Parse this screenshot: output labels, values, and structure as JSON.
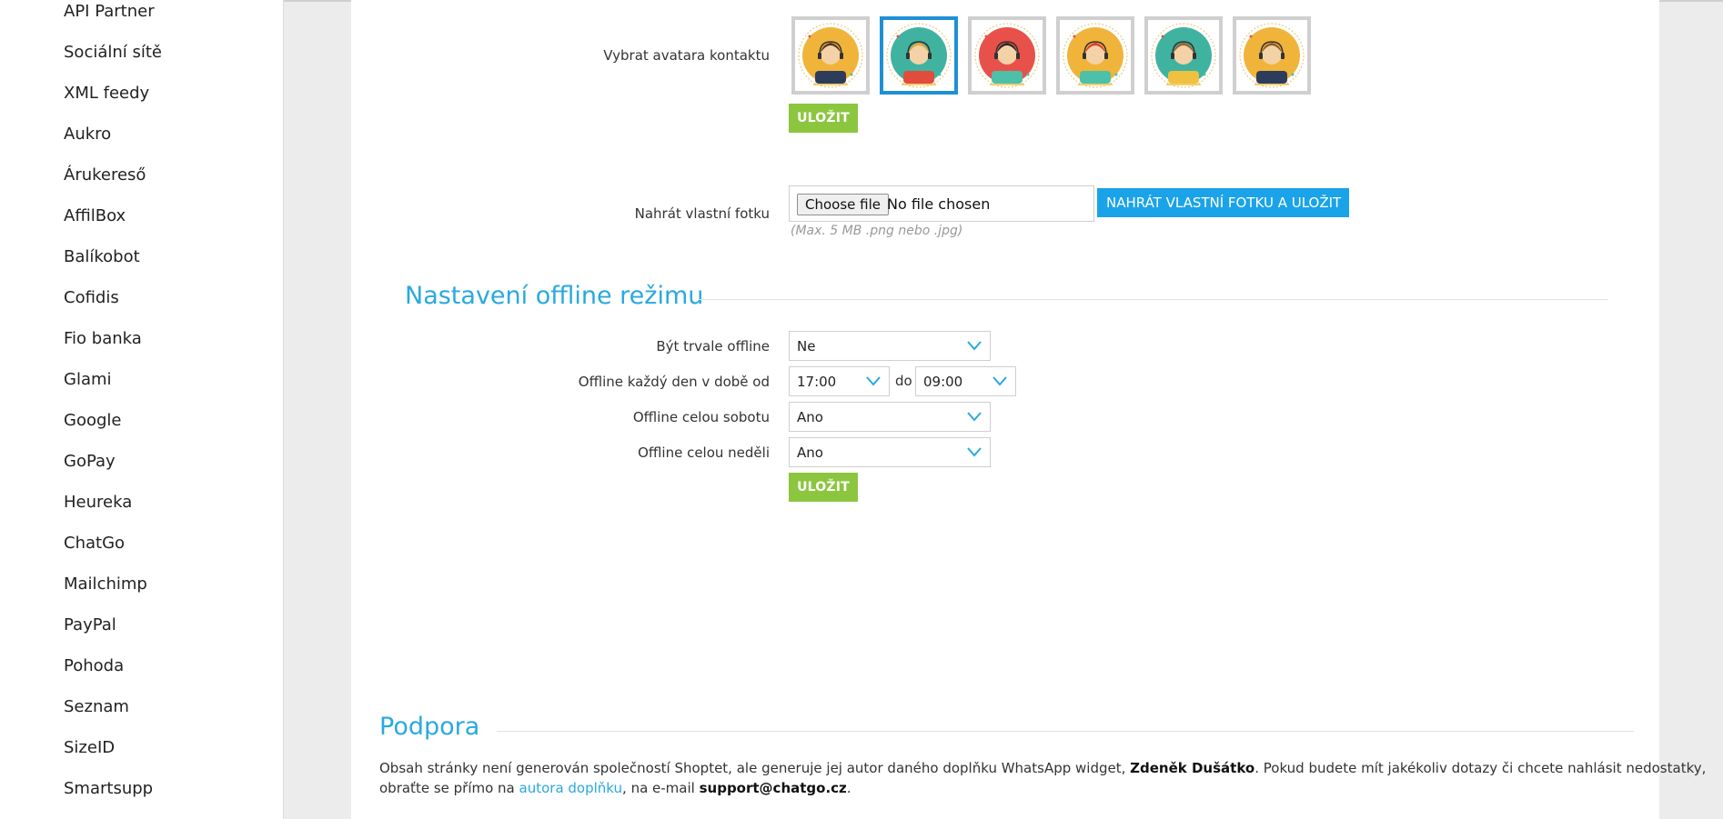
{
  "sidebar": {
    "items": [
      {
        "label": "API Partner"
      },
      {
        "label": "Sociální sítě"
      },
      {
        "label": "XML feedy"
      },
      {
        "label": "Aukro"
      },
      {
        "label": "Árukereső"
      },
      {
        "label": "AffilBox"
      },
      {
        "label": "Balíkobot"
      },
      {
        "label": "Cofidis"
      },
      {
        "label": "Fio banka"
      },
      {
        "label": "Glami"
      },
      {
        "label": "Google"
      },
      {
        "label": "GoPay"
      },
      {
        "label": "Heureka"
      },
      {
        "label": "ChatGo"
      },
      {
        "label": "Mailchimp"
      },
      {
        "label": "PayPal"
      },
      {
        "label": "Pohoda"
      },
      {
        "label": "Seznam"
      },
      {
        "label": "SizeID"
      },
      {
        "label": "Smartsupp"
      }
    ]
  },
  "avatar_section": {
    "label": "Vybrat avatara kontaktu",
    "avatars": [
      {
        "name": "avatar-woman-dark-hair",
        "bg": "#f0b43a",
        "hair": "#5a3420",
        "shirt": "#2c3d5b"
      },
      {
        "name": "avatar-man-blond",
        "bg": "#3fb3a0",
        "hair": "#e8a93a",
        "shirt": "#e24c3c"
      },
      {
        "name": "avatar-woman-black-hair",
        "bg": "#e8514a",
        "hair": "#2a2a2a",
        "shirt": "#4cc0a8"
      },
      {
        "name": "avatar-woman-red-hair",
        "bg": "#f0b43a",
        "hair": "#e03b30",
        "shirt": "#4cc0a8"
      },
      {
        "name": "avatar-man-glasses",
        "bg": "#3fb3a0",
        "hair": "#a0602a",
        "shirt": "#f0c040"
      },
      {
        "name": "avatar-man-beard",
        "bg": "#f0b43a",
        "hair": "#8a5a2a",
        "shirt": "#2c3d5b"
      }
    ],
    "selected_index": 1,
    "save_label": "ULOŽIT"
  },
  "upload_section": {
    "label": "Nahrát vlastní fotku",
    "choose_label": "Choose file",
    "no_file_label": "No file chosen",
    "upload_button": "NAHRÁT VLASTNÍ FOTKU A ULOŽIT",
    "hint": "(Max. 5 MB .png nebo .jpg)"
  },
  "offline_section": {
    "title": "Nastavení offline režimu",
    "always_offline": {
      "label": "Být trvale offline",
      "value": "Ne"
    },
    "daily": {
      "label": "Offline každý den v době od",
      "from": "17:00",
      "to_label": "do",
      "to": "09:00"
    },
    "saturday": {
      "label": "Offline celou sobotu",
      "value": "Ano"
    },
    "sunday": {
      "label": "Offline celou neděli",
      "value": "Ano"
    },
    "save_label": "ULOŽIT"
  },
  "support_section": {
    "title": "Podpora",
    "line1_pre": "Obsah stránky není generován společností Shoptet, ale generuje jej autor daného doplňku WhatsApp widget, ",
    "author_name": "Zdeněk Dušátko",
    "line1_post": ". Pokud budete mít jakékoliv dotazy či chcete nahlásit nedostatky,",
    "line2_pre": "obraťte se přímo na ",
    "author_link": "autora doplňku",
    "line2_mid": ", na e-mail ",
    "email": "support@chatgo.cz",
    "line2_post": "."
  },
  "colors": {
    "accent": "#29a9e0",
    "green_button": "#8cc63f",
    "blue_button": "#1aa3e8",
    "selected_border": "#1e90d6"
  }
}
